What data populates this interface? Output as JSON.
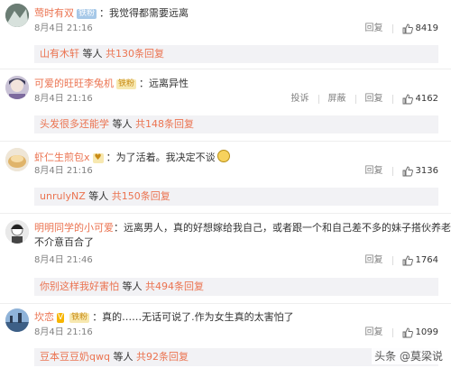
{
  "comments": [
    {
      "username": "莺时有双",
      "badge": "铁粉",
      "text": "：我觉得都需要远离",
      "date": "8月4日 21:16",
      "actions": [
        "回复"
      ],
      "likes": "8419",
      "reply": {
        "name": "山有木轩",
        "mid": " 等人 ",
        "count": "共130条回复"
      }
    },
    {
      "username": "可爱的旺旺李兔机",
      "badge": "铁粉",
      "text": "：远离异性",
      "date": "8月4日 21:16",
      "actions": [
        "投诉",
        "屏蔽",
        "回复"
      ],
      "likes": "4162",
      "reply": {
        "name": "头发很多还能学",
        "mid": " 等人 ",
        "count": "共148条回复"
      }
    },
    {
      "username": "虾仁生煎包x",
      "badge": "",
      "text": "：为了活着。我决定不谈",
      "date": "8月4日 21:16",
      "actions": [
        "回复"
      ],
      "likes": "3136",
      "reply": {
        "name": "unrulyNZ",
        "mid": " 等人 ",
        "count": "共150条回复"
      }
    },
    {
      "username": "明明同学的小可爱",
      "badge": "",
      "text": "：远离男人，真的好想嫁给我自己，或者跟一个和自己差不多的妹子搭伙养老，",
      "text2": "不介意百合了",
      "date": "8月4日 21:46",
      "actions": [
        "回复"
      ],
      "likes": "1764",
      "reply": {
        "name": "你别这样我好害怕",
        "mid": " 等人 ",
        "count": "共494条回复"
      }
    },
    {
      "username": "坎恋",
      "badge": "铁粉",
      "text": "：真的……无话可说了.作为女生真的太害怕了",
      "date": "8月4日 21:16",
      "actions": [
        "回复"
      ],
      "likes": "1099",
      "reply": {
        "name": "豆本豆豆奶qwq",
        "mid": " 等人 ",
        "count": "共92条回复"
      }
    }
  ],
  "watermark": "头条 @莫梁说"
}
